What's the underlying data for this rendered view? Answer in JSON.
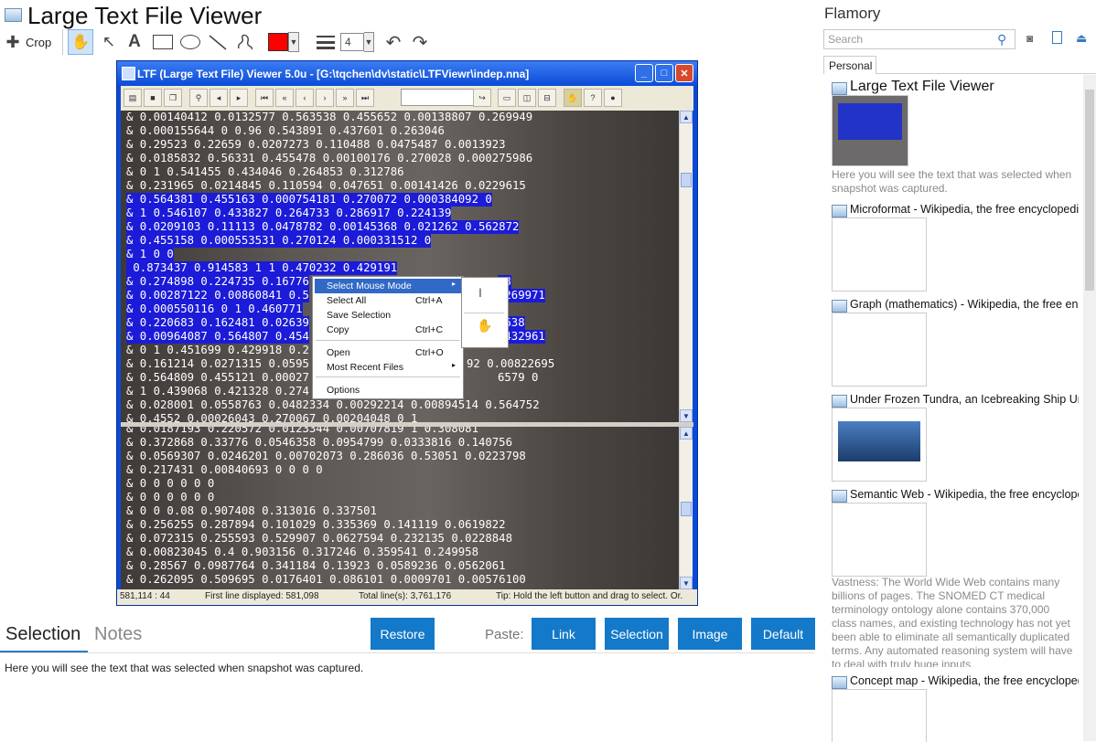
{
  "app": {
    "title": "Large Text File Viewer"
  },
  "toolbar": {
    "crop_label": "Crop",
    "line_width": "4"
  },
  "sidebar": {
    "brand": "Flamory",
    "search_placeholder": "Search",
    "tab": "Personal",
    "entries": [
      {
        "title": "Large Text File Viewer",
        "desc": "Here you will see the text that was selected when snapshot was captured."
      },
      {
        "title": "Microformat - Wikipedia, the free encyclopedia"
      },
      {
        "title": "Graph (mathematics) - Wikipedia, the free ency"
      },
      {
        "title": "Under Frozen Tundra, an Icebreaking Ship Unco"
      },
      {
        "title": "Semantic Web - Wikipedia, the free encycloped",
        "desc": "Vastness: The World Wide Web contains many billions of pages. The SNOMED CT medical terminology ontology alone contains 370,000 class names, and existing technology has not yet been able to eliminate all semantically duplicated terms. Any automated reasoning system will have to deal with truly huge inputs."
      },
      {
        "title": "Concept map - Wikipedia, the free encyclopedi"
      }
    ]
  },
  "bottom": {
    "tab_selection": "Selection",
    "tab_notes": "Notes",
    "restore": "Restore",
    "paste_label": "Paste:",
    "paste_buttons": [
      "Link",
      "Selection",
      "Image",
      "Default"
    ],
    "selection_text": "Here you will see the text that was selected when snapshot was captured."
  },
  "snapshot": {
    "window_title": "LTF (Large Text File) Viewer 5.0u - [G:\\tqchen\\dv\\static\\LTFViewr\\indep.nna]",
    "top_lines": [
      "& 0.00140412 0.0132577 0.563538 0.455652 0.00138807 0.269949",
      "& 0.000155644 0 0.96 0.543891 0.437601 0.263046",
      "& 0.29523 0.22659 0.0207273 0.110488 0.0475487 0.0013923",
      "& 0.0185832 0.56331 0.455478 0.00100176 0.270028 0.000275986",
      "& 0 1 0.541455 0.434046 0.264853 0.312786",
      "& 0.231965 0.0214845 0.110594 0.047651 0.00141426 0.0229615",
      "& 0.564381 0.455163 0.000754181 0.270072 0.000384092 0",
      "& 1 0.546107 0.433827 0.264733 0.286917 0.224139",
      "& 0.0209103 0.11113 0.0478782 0.00145368 0.021262 0.562872",
      "& 0.455158 0.000553531 0.270124 0.000331512 0",
      "& 1 0 0",
      " 0.873437 0.914583 1 1 0.470232 0.429191",
      "& 0.274898 0.224735 0.16776",
      "& 0.00287122 0.00860841 0.5",
      "& 0.000550116 0 1 0.460771",
      "& 0.220683 0.162481 0.02639",
      "& 0.00964087 0.564807 0.454",
      "& 0 1 0.451699 0.429918 0.2",
      "& 0.161214 0.0271315 0.0595",
      "& 0.564809 0.455121 0.00027",
      "& 1 0.439068 0.421328 0.274",
      "& 0.028001 0.0558763 0.0482334 0.00292214 0.00894514 0.564752",
      "& 0.4552 0.00026043 0.270067 0.00204048 0 1"
    ],
    "right_fragments": [
      {
        "row": 12,
        "text": "88"
      },
      {
        "row": 13,
        "text": ".269971"
      },
      {
        "row": 15,
        "text": "0638"
      },
      {
        "row": 16,
        "text": "0432961"
      },
      {
        "row": 18,
        "text": "92 0.00822695"
      },
      {
        "row": 19,
        "text": "6579 0"
      }
    ],
    "bottom_lines": [
      "& 0.0187193 0.220572 0.0123344 0.00707819 1 0.308081",
      "& 0.372868 0.33776 0.0546358 0.0954799 0.0333816 0.140756",
      "& 0.0569307 0.0246201 0.00702073 0.286036 0.53051 0.0223798",
      "& 0.217431 0.00840693 0 0 0 0",
      "& 0 0 0 0 0 0",
      "& 0 0 0 0 0 0",
      "& 0 0 0.08 0.907408 0.313016 0.337501",
      "& 0.256255 0.287894 0.101029 0.335369 0.141119 0.0619822",
      "& 0.072315 0.255593 0.529907 0.0627594 0.232135 0.0228848",
      "& 0.00823045 0.4 0.903156 0.317246 0.359541 0.249958",
      "& 0.28567 0.0987764 0.341184 0.13923 0.0589236 0.0562061",
      "& 0.262095 0.509695 0.0176401 0.086101 0.0009701 0.00576100"
    ],
    "context_menu": [
      {
        "label": "Select Mouse Mode",
        "key": "",
        "arrow": "▸"
      },
      {
        "label": "Select All",
        "key": "Ctrl+A"
      },
      {
        "label": "Save Selection",
        "key": ""
      },
      {
        "label": "Copy",
        "key": "Ctrl+C"
      },
      {
        "label": "Open",
        "key": "Ctrl+O"
      },
      {
        "label": "Most Recent Files",
        "key": "",
        "arrow": "▸"
      },
      {
        "label": "Options",
        "key": ""
      }
    ],
    "status": {
      "pos": "581,114 : 44",
      "first_line": "First line displayed: 581,098",
      "total": "Total line(s): 3,761,176",
      "tip": "Tip: Hold the left button and drag to select. Or."
    }
  },
  "colors": {
    "accent": "#1479c9",
    "selection_highlight": "#1b1bd8",
    "shape_color": "#ff0000"
  }
}
